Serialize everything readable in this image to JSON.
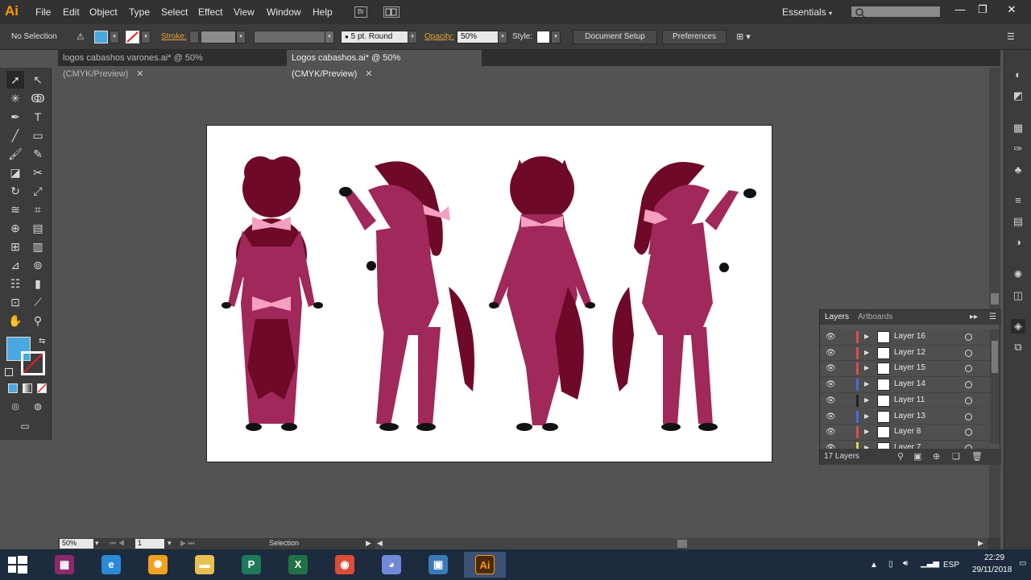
{
  "app": {
    "logo": "Ai"
  },
  "menu": [
    "File",
    "Edit",
    "Object",
    "Type",
    "Select",
    "Effect",
    "View",
    "Window",
    "Help"
  ],
  "menubar": {
    "bridge_label": "Br",
    "workspace": "Essentials"
  },
  "window_controls": {
    "minimize": "—",
    "restore": "❐",
    "close": "✕"
  },
  "control": {
    "selection": "No Selection",
    "stroke_label": "Stroke:",
    "brush": "5 pt. Round",
    "opacity_label": "Opacity:",
    "opacity_value": "50%",
    "style_label": "Style:",
    "document_setup": "Document Setup",
    "preferences": "Preferences",
    "fill_color": "#4aa8e0"
  },
  "tabs": [
    {
      "label": "logos cabashos varones.ai* @ 50% (CMYK/Preview)",
      "close": "✕"
    },
    {
      "label": "Logos cabashos.ai* @ 50% (CMYK/Preview)",
      "close": "✕"
    }
  ],
  "layers": {
    "tab_layers": "Layers",
    "tab_artboards": "Artboards",
    "count": "17 Layers",
    "rows": [
      {
        "name": "Layer 16",
        "color": "#e04a4a"
      },
      {
        "name": "Layer 12",
        "color": "#e04a4a"
      },
      {
        "name": "Layer 15",
        "color": "#e04a4a"
      },
      {
        "name": "Layer 14",
        "color": "#4a6ae0"
      },
      {
        "name": "Layer 11",
        "color": "#222222"
      },
      {
        "name": "Layer 13",
        "color": "#4a6ae0"
      },
      {
        "name": "Layer 8",
        "color": "#e04a4a"
      },
      {
        "name": "Layer 7",
        "color": "#e0d04a"
      }
    ]
  },
  "status": {
    "zoom": "50%",
    "artboard": "1",
    "tool": "Selection"
  },
  "taskbar": {
    "apps": [
      {
        "name": "winrar",
        "glyph": "▦",
        "color": "#8a2a6a"
      },
      {
        "name": "internet-explorer",
        "glyph": "e",
        "color": "#2a8ad8"
      },
      {
        "name": "app-orange",
        "glyph": "✺",
        "color": "#f0a020"
      },
      {
        "name": "file-explorer",
        "glyph": "▬",
        "color": "#e8c050"
      },
      {
        "name": "publisher",
        "glyph": "P",
        "color": "#1e7a5a"
      },
      {
        "name": "excel",
        "glyph": "X",
        "color": "#207245"
      },
      {
        "name": "chrome",
        "glyph": "◉",
        "color": "#dd4b39"
      },
      {
        "name": "discord",
        "glyph": "◕",
        "color": "#7289da"
      },
      {
        "name": "photos",
        "glyph": "▣",
        "color": "#3a7ab8"
      },
      {
        "name": "illustrator",
        "glyph": "Ai",
        "color": "#4a2a08"
      }
    ]
  },
  "tray": {
    "lang": "ESP",
    "time": "22:29",
    "date": "29/11/2018"
  },
  "artwork": {
    "body": "#a0285a",
    "dark": "#6e0a28",
    "bow": "#f5a0c0",
    "hoof": "#111111"
  }
}
